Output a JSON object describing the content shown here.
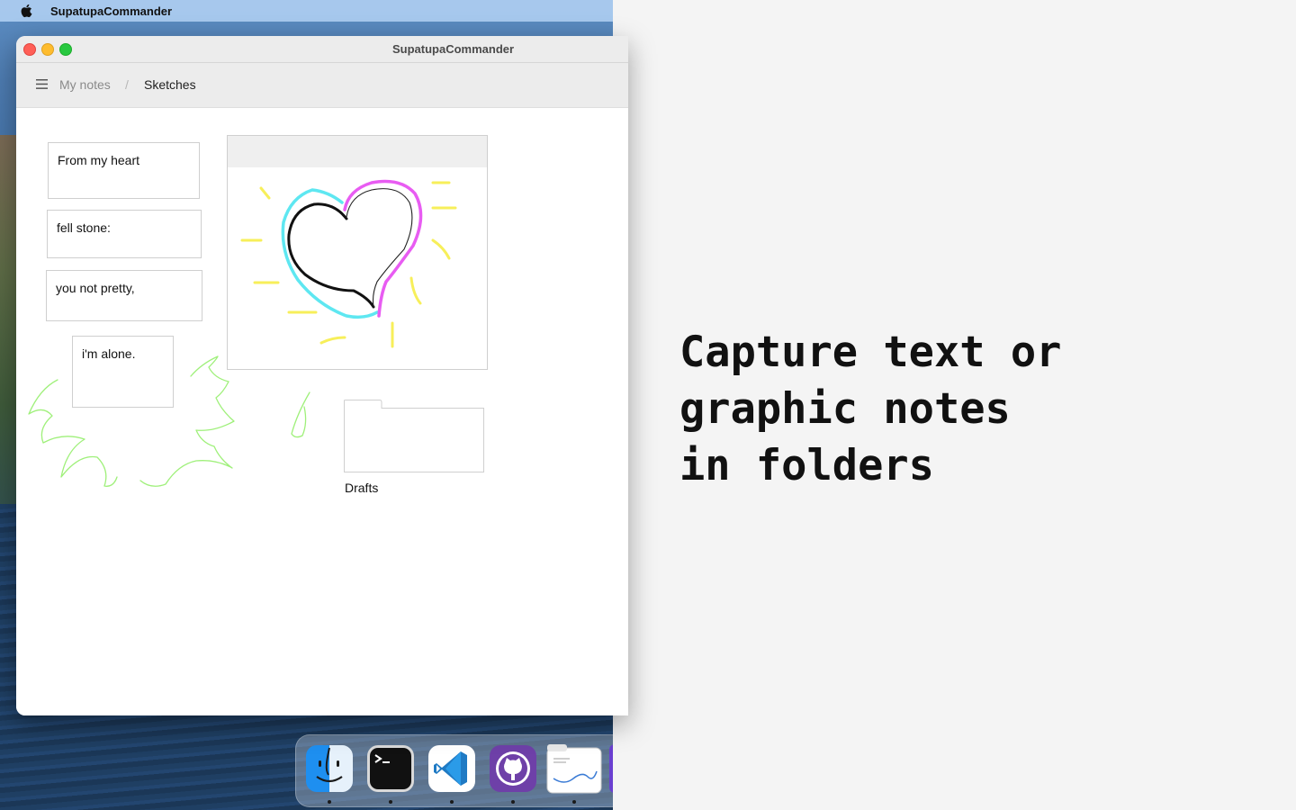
{
  "menubar": {
    "app_name": "SupatupaCommander"
  },
  "window": {
    "title": "SupatupaCommander",
    "breadcrumb": {
      "root": "My notes",
      "separator": "/",
      "current": "Sketches"
    }
  },
  "notes": [
    {
      "text": "From my heart"
    },
    {
      "text": "fell stone:"
    },
    {
      "text": "you not pretty,"
    },
    {
      "text": "i'm alone."
    }
  ],
  "folder": {
    "label": "Drafts"
  },
  "dock": {
    "apps": [
      "finder-icon",
      "terminal-icon",
      "vscode-icon",
      "github-desktop-icon",
      "supatupa-commander-icon"
    ]
  },
  "promo": {
    "lines": [
      "Capture text or",
      "graphic notes",
      "in folders"
    ]
  },
  "colors": {
    "sketch_black": "#111111",
    "sketch_cyan": "#5ee7f1",
    "sketch_magenta": "#e85cf2",
    "sketch_yellow": "#f7ef5a",
    "scribble_green": "#9ff07a"
  }
}
